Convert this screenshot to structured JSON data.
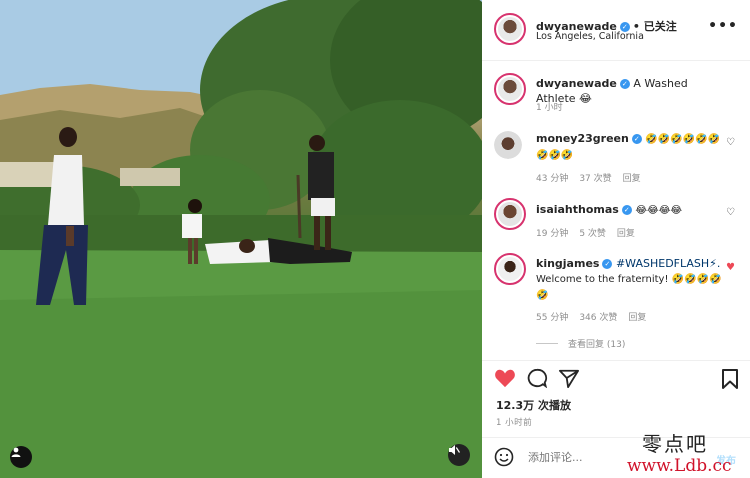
{
  "header": {
    "username": "dwyanewade",
    "follow_state": "• 已关注",
    "location": "Los Angeles, California",
    "more_icon": "more-horizontal-icon"
  },
  "caption": {
    "username": "dwyanewade",
    "text": "A Washed Athlete 😂",
    "time": "1 小时"
  },
  "comments": [
    {
      "username": "money23green",
      "text": "🤣🤣🤣🤣🤣🤣🤣🤣🤣",
      "time": "43 分钟",
      "likes": "37 次赞",
      "reply": "回复",
      "liked": false
    },
    {
      "username": "isaiahthomas",
      "text": "😂😂😂😂",
      "time": "19 分钟",
      "likes": "5 次赞",
      "reply": "回复",
      "liked": false
    },
    {
      "username": "kingjames",
      "hashtag": "#WASHEDFLASH⚡.",
      "text": "Welcome to the fraternity! 🤣🤣🤣🤣🤣",
      "time": "55 分钟",
      "likes": "346 次赞",
      "reply": "回复",
      "view_replies": "查看回复 (13)",
      "liked": true
    }
  ],
  "actions": {
    "like_icon": "heart-filled-icon",
    "comment_icon": "comment-icon",
    "share_icon": "send-icon",
    "save_icon": "bookmark-icon",
    "like_color": "#ed4956"
  },
  "likes_text": "12.3万 次播放",
  "time_ago": "1 小时前",
  "comment_box": {
    "placeholder": "添加评论...",
    "post_label": "发布"
  },
  "watermark": {
    "line1": "零点吧",
    "line2": "www.Ldb.cc"
  }
}
